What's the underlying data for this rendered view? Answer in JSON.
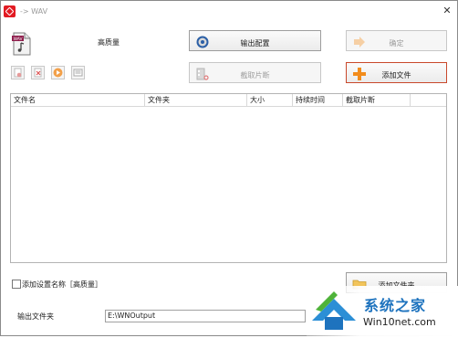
{
  "window": {
    "title": "-> WAV"
  },
  "preset": {
    "name": "高质量"
  },
  "buttons": {
    "output_config": "输出配置",
    "ok": "确定",
    "clip": "截取片断",
    "add_file": "添加文件",
    "add_folder": "添加文件夹"
  },
  "table": {
    "columns": [
      "文件名",
      "文件夹",
      "大小",
      "持续时间",
      "截取片断"
    ]
  },
  "options": {
    "append_setting_name": "添加设置名称［高质量］"
  },
  "output": {
    "label": "输出文件夹",
    "path": "E:\\WNOutput"
  },
  "watermark": {
    "title": "系统之家",
    "url": "Win10net.com"
  },
  "colors": {
    "accent_orange": "#f28c1c",
    "accent_red": "#e21b23",
    "watermark_blue": "#1e73be"
  }
}
